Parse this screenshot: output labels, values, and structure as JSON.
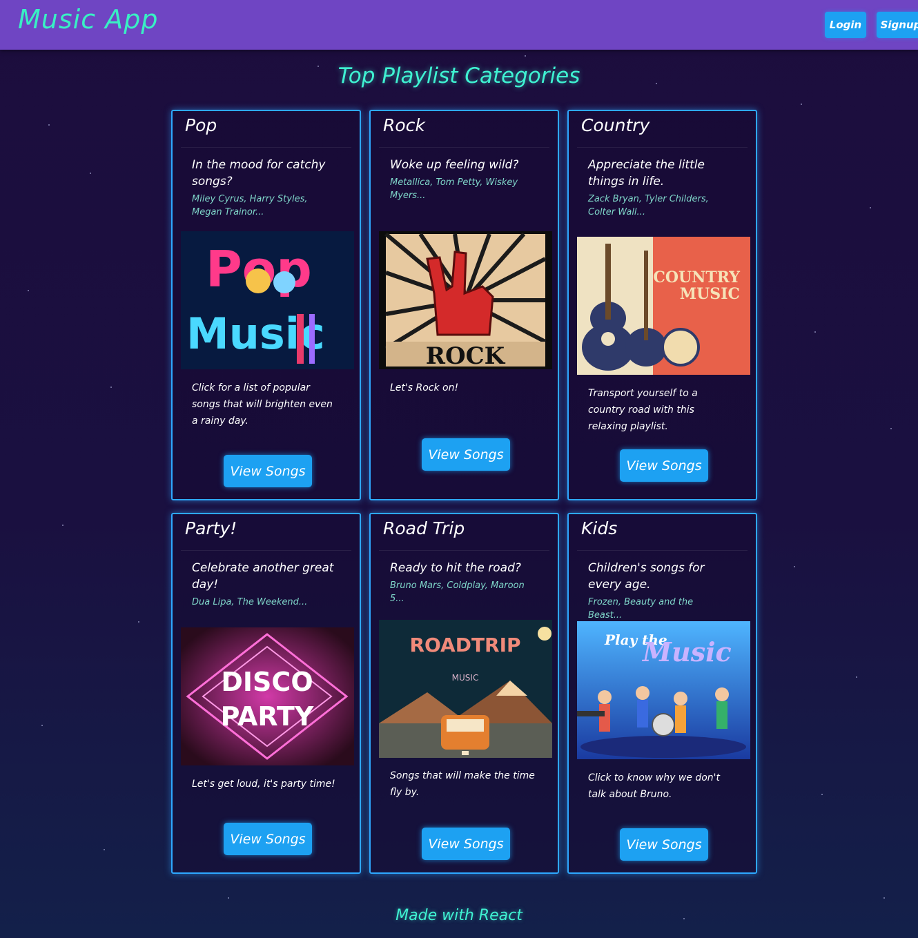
{
  "nav": {
    "brand": "Music App",
    "login_label": "Login",
    "signup_label": "Signup"
  },
  "page": {
    "title": "Top Playlist Categories"
  },
  "cards": [
    {
      "title": "Pop",
      "question": "In the mood for catchy songs?",
      "artists": "Miley Cyrus, Harry Styles, Megan Trainor...",
      "image_text": [
        "Pop",
        "Music"
      ],
      "description": "Click for a list of popular songs that will brighten even a rainy day.",
      "button_label": "View Songs"
    },
    {
      "title": "Rock",
      "question": "Woke up feeling wild?",
      "artists": "Metallica, Tom Petty, Wiskey Myers...",
      "image_text": [
        "ROCK"
      ],
      "description": "Let's Rock on!",
      "button_label": "View Songs"
    },
    {
      "title": "Country",
      "question": "Appreciate the little things in life.",
      "artists": "Zack Bryan, Tyler Childers, Colter Wall...",
      "image_text": [
        "COUNTRY",
        "MUSIC"
      ],
      "description": "Transport yourself to a country road with this relaxing playlist.",
      "button_label": "View Songs"
    },
    {
      "title": "Party!",
      "question": "Celebrate another great day!",
      "artists": "Dua Lipa, The Weekend...",
      "image_text": [
        "DISCO",
        "PARTY"
      ],
      "description": "Let's get loud, it's party time!",
      "button_label": "View Songs"
    },
    {
      "title": "Road Trip",
      "question": "Ready to hit the road?",
      "artists": "Bruno Mars, Coldplay, Maroon 5...",
      "image_text": [
        "ROADTRIP",
        "MUSIC"
      ],
      "description": "Songs that will make the time fly by.",
      "button_label": "View Songs"
    },
    {
      "title": "Kids",
      "question": "Children's songs for every age.",
      "artists": "Frozen, Beauty and the Beast...",
      "image_text": [
        "Play the",
        "Music"
      ],
      "description": "Click to know why we don't talk about Bruno.",
      "button_label": "View Songs"
    }
  ],
  "footer": {
    "text": "Made with React"
  },
  "colors": {
    "navbar": "#6f45c3",
    "accent_teal": "#3ff2d2",
    "button_blue": "#1da1f2",
    "card_border": "#2ea8ff",
    "background": "#1c0d3d"
  }
}
